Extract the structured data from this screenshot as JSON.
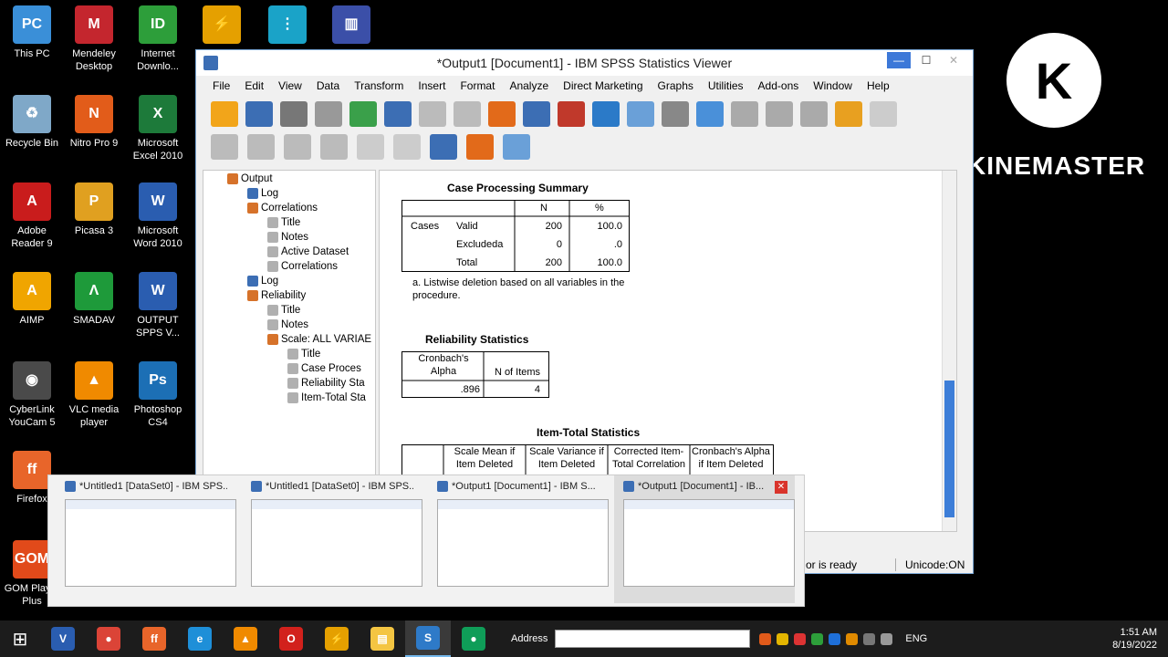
{
  "desktop": {
    "icons": [
      {
        "label": "This PC",
        "icon": "computer-icon",
        "color": "#3a8fd8"
      },
      {
        "label": "Mendeley Desktop",
        "icon": "mendeley-icon",
        "color": "#c4262e"
      },
      {
        "label": "Internet Downlo...",
        "icon": "idm-icon",
        "color": "#2d9e3a"
      },
      {
        "label": "",
        "icon": "plug-icon",
        "color": "#e5a000"
      },
      {
        "label": "",
        "icon": "network-icon",
        "color": "#1aa3c8"
      },
      {
        "label": "",
        "icon": "chart-icon",
        "color": "#3b4fa8"
      },
      {
        "label": "Recycle Bin",
        "icon": "recycle-bin-icon",
        "color": "#7fa8c8"
      },
      {
        "label": "Nitro Pro 9",
        "icon": "nitro-icon",
        "color": "#e25c1a"
      },
      {
        "label": "Microsoft Excel 2010",
        "icon": "excel-icon",
        "color": "#1d7a3a"
      },
      {
        "label": "Adobe Reader 9",
        "icon": "adobe-reader-icon",
        "color": "#c91c1c"
      },
      {
        "label": "Picasa 3",
        "icon": "picasa-icon",
        "color": "#e0a020"
      },
      {
        "label": "Microsoft Word 2010",
        "icon": "word-icon",
        "color": "#2a5db0"
      },
      {
        "label": "AIMP",
        "icon": "aimp-icon",
        "color": "#f0a500"
      },
      {
        "label": "SMADAV",
        "icon": "smadav-icon",
        "color": "#1e9a3a"
      },
      {
        "label": "OUTPUT SPPS V...",
        "icon": "document-icon",
        "color": "#2a5db0"
      },
      {
        "label": "CyberLink YouCam 5",
        "icon": "webcam-icon",
        "color": "#4a4a4a"
      },
      {
        "label": "VLC media player",
        "icon": "vlc-icon",
        "color": "#f08a00"
      },
      {
        "label": "Photoshop CS4",
        "icon": "photoshop-icon",
        "color": "#1c6fb5"
      },
      {
        "label": "Firefox",
        "icon": "firefox-icon",
        "color": "#e8652a"
      },
      {
        "label": "GOM Player Plus",
        "icon": "gom-icon",
        "color": "#e14a1a"
      }
    ],
    "icon_letters": [
      "PC",
      "M",
      "ID",
      "⚡",
      "⋮",
      "▥",
      "♻",
      "N",
      "X",
      "A",
      "P",
      "W",
      "A",
      "Λ",
      "W",
      "◉",
      "▲",
      "Ps",
      "ff",
      "GOM"
    ]
  },
  "watermark": {
    "text": "KINEMASTER",
    "logo_letter": "K"
  },
  "window": {
    "title": "*Output1 [Document1] - IBM SPSS Statistics Viewer",
    "menu": [
      "File",
      "Edit",
      "View",
      "Data",
      "Transform",
      "Insert",
      "Format",
      "Analyze",
      "Direct Marketing",
      "Graphs",
      "Utilities",
      "Add-ons",
      "Window",
      "Help"
    ],
    "toolbar_icons": [
      "open-icon",
      "save-icon",
      "print-icon",
      "print-preview-icon",
      "export-icon",
      "recall-dialog-icon",
      "undo-icon",
      "redo-icon",
      "goto-case-icon",
      "goto-variable-icon",
      "variables-icon",
      "split-file-icon",
      "select-cases-icon",
      "value-labels-icon",
      "use-sets-icon",
      "designate-window-icon",
      "promote-icon",
      "demote-icon",
      "show-icon",
      "hide-icon"
    ],
    "toolbar2_icons": [
      "back-icon",
      "forward-icon",
      "expand-icon",
      "collapse-icon",
      "show-all-icon",
      "hide-all-icon",
      "insert-heading-icon",
      "insert-title-icon",
      "insert-text-icon"
    ],
    "outline": [
      {
        "label": "Output",
        "depth": 0,
        "kind": "folder"
      },
      {
        "label": "Log",
        "depth": 1,
        "kind": "log"
      },
      {
        "label": "Correlations",
        "depth": 1,
        "kind": "folder"
      },
      {
        "label": "Title",
        "depth": 2,
        "kind": "item"
      },
      {
        "label": "Notes",
        "depth": 2,
        "kind": "item"
      },
      {
        "label": "Active Dataset",
        "depth": 2,
        "kind": "item"
      },
      {
        "label": "Correlations",
        "depth": 2,
        "kind": "item"
      },
      {
        "label": "Log",
        "depth": 1,
        "kind": "log"
      },
      {
        "label": "Reliability",
        "depth": 1,
        "kind": "folder"
      },
      {
        "label": "Title",
        "depth": 2,
        "kind": "item"
      },
      {
        "label": "Notes",
        "depth": 2,
        "kind": "item"
      },
      {
        "label": "Scale: ALL VARIAE",
        "depth": 2,
        "kind": "folder"
      },
      {
        "label": "Title",
        "depth": 3,
        "kind": "item"
      },
      {
        "label": "Case Proces",
        "depth": 3,
        "kind": "item"
      },
      {
        "label": "Reliability Sta",
        "depth": 3,
        "kind": "item"
      },
      {
        "label": "Item-Total Sta",
        "depth": 3,
        "kind": "item"
      }
    ],
    "case_processing": {
      "title": "Case Processing Summary",
      "col_n": "N",
      "col_pct": "%",
      "group": "Cases",
      "rows": [
        {
          "label": "Valid",
          "n": "200",
          "pct": "100.0"
        },
        {
          "label": "Excludeda",
          "n": "0",
          "pct": ".0"
        },
        {
          "label": "Total",
          "n": "200",
          "pct": "100.0"
        }
      ],
      "footnote": "a. Listwise deletion based on all variables in the procedure."
    },
    "reliability": {
      "title": "Reliability Statistics",
      "col1": "Cronbach's Alpha",
      "col2": "N of Items",
      "alpha": ".896",
      "items": "4"
    },
    "item_total": {
      "title": "Item-Total Statistics",
      "cols": [
        "Scale Mean if Item Deleted",
        "Scale Variance if Item Deleted",
        "Corrected Item-Total Correlation",
        "Cronbach's Alpha if Item Deleted"
      ]
    },
    "status": {
      "processor": "or is ready",
      "unicode": "Unicode:ON"
    }
  },
  "previews": [
    {
      "title": "*Untitled1 [DataSet0] - IBM SPS...",
      "active": false
    },
    {
      "title": "*Untitled1 [DataSet0] - IBM SPS...",
      "active": false
    },
    {
      "title": "*Output1 [Document1] - IBM S...",
      "active": false
    },
    {
      "title": "*Output1 [Document1] - IB...",
      "active": true
    }
  ],
  "taskbar": {
    "apps": [
      {
        "icon": "visual-studio-icon",
        "color": "#2a5db0",
        "letter": "V"
      },
      {
        "icon": "chrome-icon",
        "color": "#db4437",
        "letter": "●"
      },
      {
        "icon": "firefox-icon",
        "color": "#e8652a",
        "letter": "ff"
      },
      {
        "icon": "ie-icon",
        "color": "#1e8fd8",
        "letter": "e"
      },
      {
        "icon": "vlc-icon",
        "color": "#f08a00",
        "letter": "▲"
      },
      {
        "icon": "opera-icon",
        "color": "#d2211c",
        "letter": "O"
      },
      {
        "icon": "plug-icon",
        "color": "#e5a000",
        "letter": "⚡"
      },
      {
        "icon": "explorer-icon",
        "color": "#f4c542",
        "letter": "▤"
      },
      {
        "icon": "spss-icon",
        "color": "#2e7ac8",
        "letter": "S"
      },
      {
        "icon": "chrome-icon",
        "color": "#0f9d58",
        "letter": "●"
      }
    ],
    "address_label": "Address",
    "lang": "ENG",
    "time": "1:51 AM",
    "date": "8/19/2022"
  }
}
